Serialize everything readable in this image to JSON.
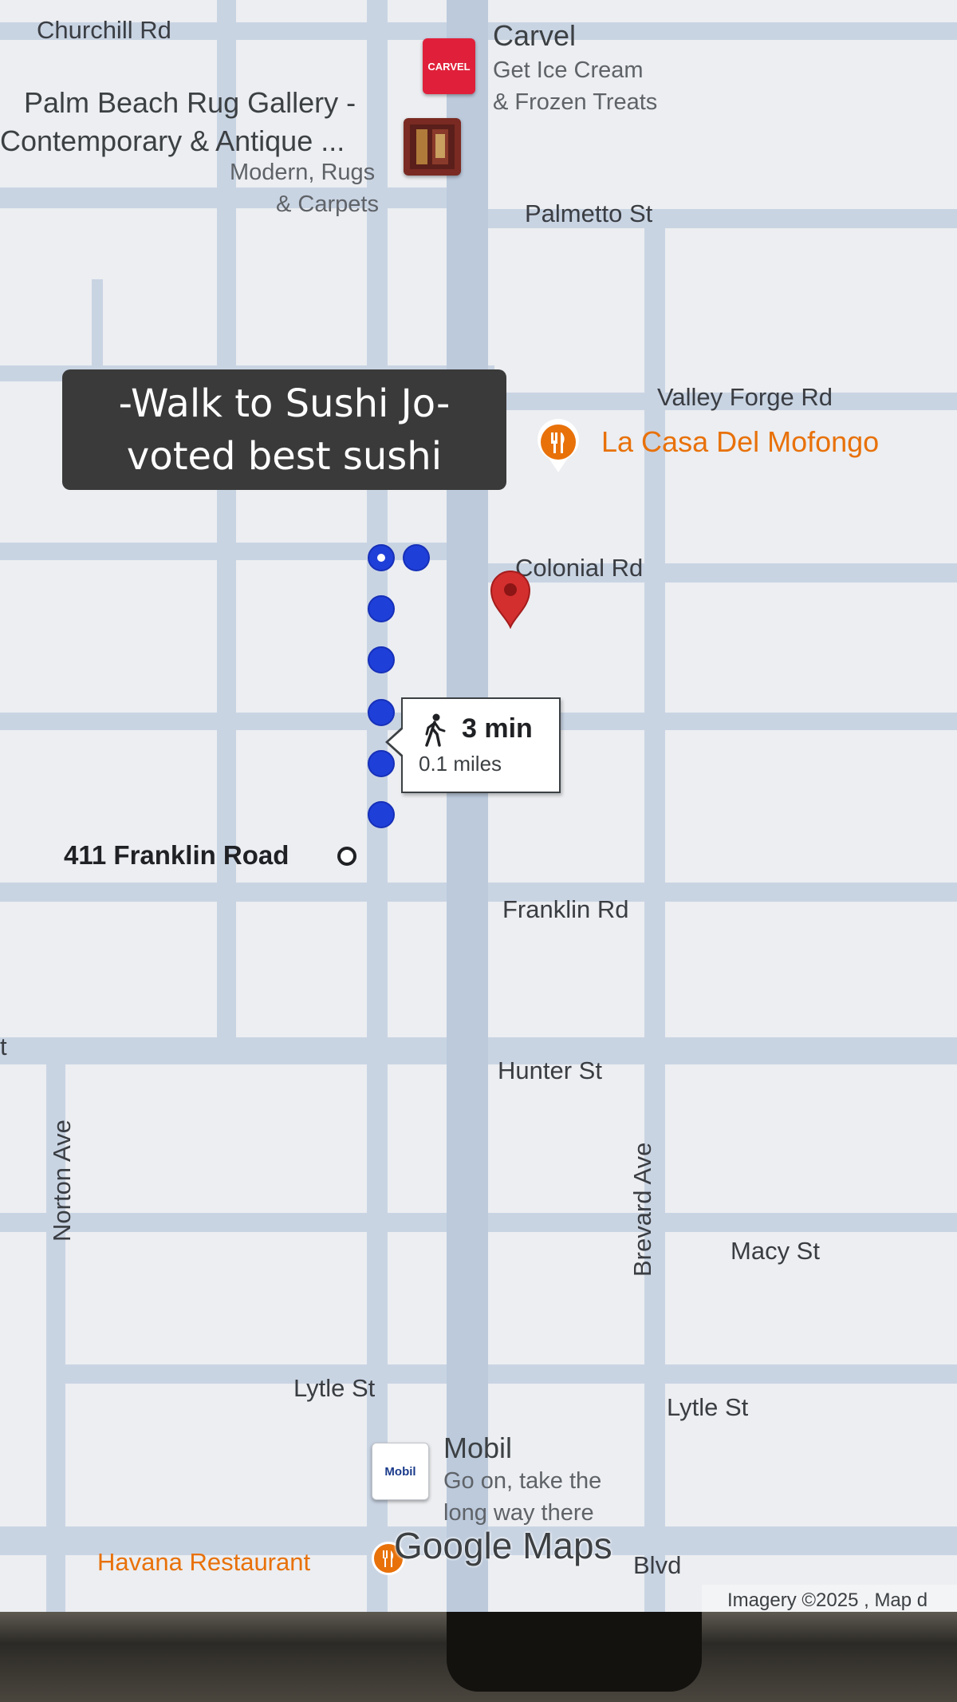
{
  "caption": {
    "line1": "-Walk to Sushi Jo-",
    "line2": "voted best sushi"
  },
  "streets": {
    "churchill": "Churchill Rd",
    "palmetto": "Palmetto St",
    "valley_forge": "Valley Forge Rd",
    "colonial": "Colonial Rd",
    "franklin": "Franklin Rd",
    "hunter": "Hunter St",
    "norton": "Norton Ave",
    "brevard": "Brevard Ave",
    "macy": "Macy St",
    "lytle_left": "Lytle St",
    "lytle_right": "Lytle St",
    "blvd": "Blvd",
    "edge_letter": "t"
  },
  "pois": {
    "carvel": {
      "name": "Carvel",
      "sub1": "Get Ice Cream",
      "sub2": "& Frozen Treats",
      "logo": "CARVEL"
    },
    "rug_gallery": {
      "name1": "Palm Beach Rug Gallery -",
      "name2": "Contemporary & Antique ...",
      "sub1": "Modern, Rugs",
      "sub2": "& Carpets"
    },
    "la_casa": {
      "name": "La Casa Del Mofongo",
      "icon": "fork-knife-icon"
    },
    "mobil": {
      "name": "Mobil",
      "sub1": "Go on, take the",
      "sub2": "long way there",
      "logo": "Mobil"
    },
    "havana": {
      "name": "Havana Restaurant"
    }
  },
  "route": {
    "duration": "3 min",
    "distance": "0.1 miles",
    "origin_label": "411 Franklin Road",
    "mode_icon": "walking-person-icon",
    "route_color": "#1f3fd9"
  },
  "branding": {
    "watermark": "Google Maps",
    "attribution": "Imagery ©2025 , Map d"
  },
  "colors": {
    "road": "#c9d4e3",
    "pin": "#d32f2f",
    "restaurant": "#e8710a"
  }
}
